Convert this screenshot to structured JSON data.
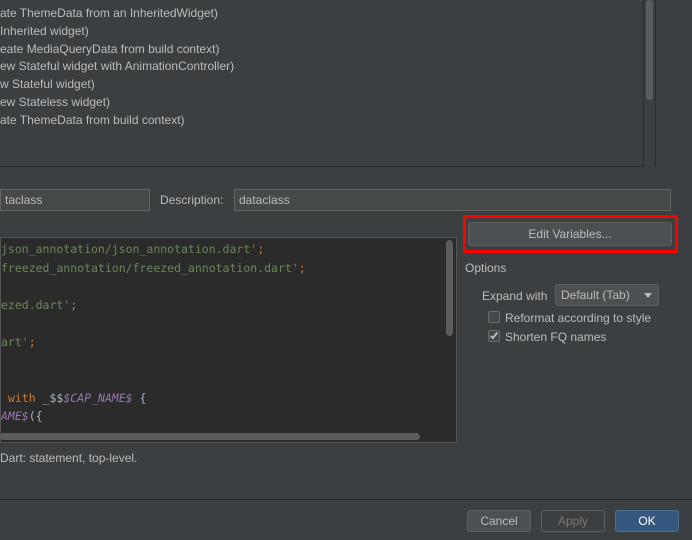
{
  "templates": [
    "ate ThemeData from an InheritedWidget)",
    "Inherited widget)",
    "eate MediaQueryData from build context)",
    "ew Stateful widget with AnimationController)",
    "w Stateful widget)",
    "ew Stateless widget)",
    "ate ThemeData from build context)"
  ],
  "abbreviation": {
    "value": "taclass"
  },
  "description": {
    "label": "Description:",
    "value": "dataclass"
  },
  "code": [
    [
      {
        "t": "json_annotation/json_annotation.dart'",
        "c": "c-str"
      },
      {
        "t": ";",
        "c": "c-punc"
      }
    ],
    [
      {
        "t": "freezed_annotation/freezed_annotation.dart'",
        "c": "c-str"
      },
      {
        "t": ";",
        "c": "c-punc"
      }
    ],
    [],
    [
      {
        "t": "ezed.dart'",
        "c": "c-str"
      },
      {
        "t": ";",
        "c": "c-punc"
      }
    ],
    [],
    [
      {
        "t": "art'",
        "c": "c-str"
      },
      {
        "t": ";",
        "c": "c-punc"
      }
    ],
    [],
    [],
    [
      {
        "t": " with ",
        "c": "c-kw"
      },
      {
        "t": "_$$",
        "c": "c-plain"
      },
      {
        "t": "$CAP_NAME$",
        "c": "c-var"
      },
      {
        "t": " {",
        "c": "c-plain"
      }
    ],
    [
      {
        "t": "AME$",
        "c": "c-var"
      },
      {
        "t": "({",
        "c": "c-plain"
      }
    ]
  ],
  "applicable": "Dart: statement, top-level.",
  "edit_variables_label": "Edit Variables...",
  "options": {
    "title": "Options",
    "expand_label": "Expand with",
    "expand_value": "Default (Tab)",
    "reformat_label": "Reformat according to style",
    "reformat_checked": false,
    "shorten_label": "Shorten FQ names",
    "shorten_checked": true
  },
  "footer": {
    "cancel": "Cancel",
    "apply": "Apply",
    "ok": "OK"
  },
  "colors": {
    "accent": "#365880",
    "highlight": "#ff0000",
    "background": "#3c3f41"
  }
}
